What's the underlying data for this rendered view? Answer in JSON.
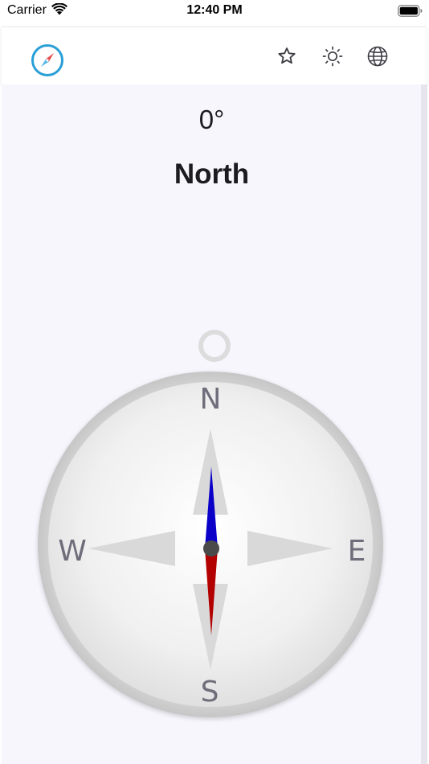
{
  "status_bar": {
    "carrier": "Carrier",
    "time": "12:40 PM",
    "icons": [
      "wifi-icon",
      "battery-icon"
    ]
  },
  "app_bar": {
    "logo_icon": "compass-logo-icon",
    "actions": [
      {
        "icon": "star-icon"
      },
      {
        "icon": "brightness-icon"
      },
      {
        "icon": "globe-icon"
      }
    ]
  },
  "heading": {
    "degrees": "0°",
    "direction": "North"
  },
  "compass": {
    "heading_degrees": 0,
    "cardinals": {
      "north": "N",
      "east": "E",
      "south": "S",
      "west": "W"
    },
    "colors": {
      "needle_north": "#0a00c8",
      "needle_south": "#b30000",
      "face": "#eeeeee",
      "rim": "#d2d2d2",
      "pointer": "#d9d9d9",
      "hub": "#4a4a4a",
      "letters": "#6f6d7a",
      "accent": "#2a9fd6"
    }
  }
}
